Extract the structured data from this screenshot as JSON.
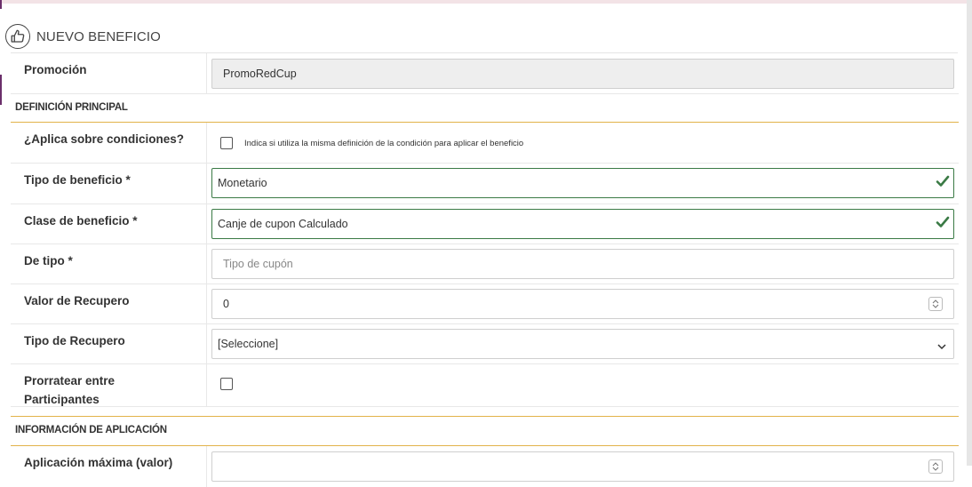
{
  "header": {
    "title": "NUEVO BENEFICIO",
    "icon": "thumbs-up-icon"
  },
  "promocion": {
    "label": "Promoción",
    "value": "PromoRedCup"
  },
  "sections": {
    "principal": "DEFINICIÓN PRINCIPAL",
    "aplicacion": "INFORMACIÓN DE APLICACIÓN"
  },
  "fields": {
    "aplica": {
      "label": "¿Aplica sobre condiciones?",
      "hint": "Indica si utiliza la misma definición de la condición para aplicar el beneficio",
      "checked": false
    },
    "tipo_beneficio": {
      "label": "Tipo de beneficio *",
      "value": "Monetario"
    },
    "clase_beneficio": {
      "label": "Clase de beneficio *",
      "value": "Canje de cupon Calculado"
    },
    "de_tipo": {
      "label": "De tipo *",
      "placeholder": "Tipo de cupón"
    },
    "valor_recupero": {
      "label": "Valor de Recupero",
      "value": "0"
    },
    "tipo_recupero": {
      "label": "Tipo de Recupero",
      "value": "[Seleccione]"
    },
    "prorratear": {
      "label_line1": "Prorratear entre",
      "label_line2": "Participantes",
      "checked": false
    },
    "aplicacion_maxima": {
      "label": "Aplicación máxima (valor)"
    }
  },
  "colors": {
    "valid_border": "#3a7a45",
    "section_rule": "#e2b34a",
    "readonly_bg": "#eeeeee"
  }
}
